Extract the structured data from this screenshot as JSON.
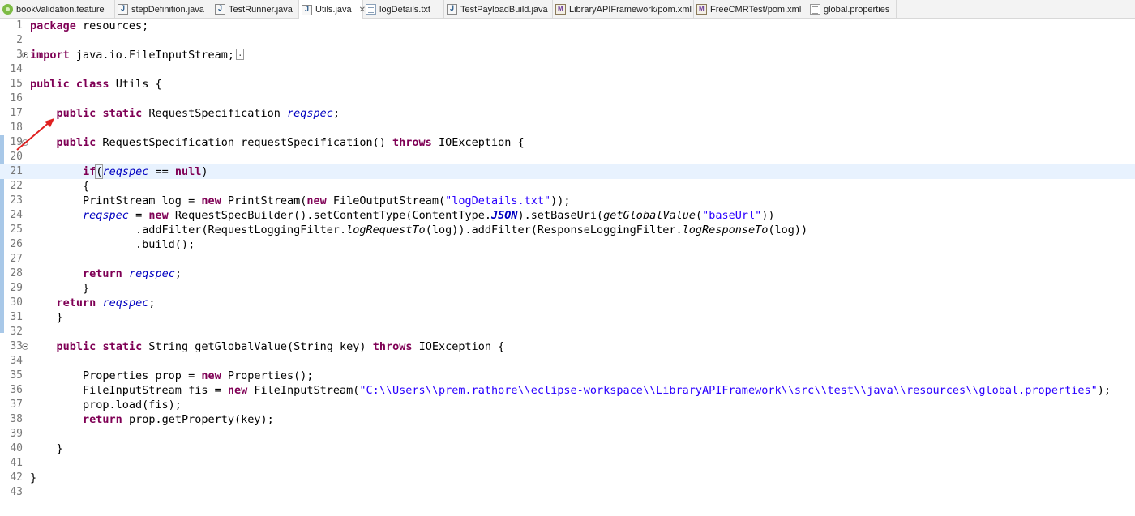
{
  "tabs": [
    {
      "label": "bookValidation.feature",
      "icon": "cucumber-feature-icon",
      "active": false
    },
    {
      "label": "stepDefinition.java",
      "icon": "java-file-icon",
      "active": false
    },
    {
      "label": "TestRunner.java",
      "icon": "java-file-icon",
      "active": false
    },
    {
      "label": "Utils.java",
      "icon": "java-file-icon",
      "active": true,
      "close": "✕"
    },
    {
      "label": "logDetails.txt",
      "icon": "text-file-icon",
      "active": false
    },
    {
      "label": "TestPayloadBuild.java",
      "icon": "java-file-icon",
      "active": false
    },
    {
      "label": "LibraryAPIFramework/pom.xml",
      "icon": "maven-pom-icon",
      "active": false
    },
    {
      "label": "FreeCMRTest/pom.xml",
      "icon": "maven-pom-icon",
      "active": false
    },
    {
      "label": "global.properties",
      "icon": "properties-file-icon",
      "active": false
    }
  ],
  "editor": {
    "current_line": "21",
    "lines": [
      {
        "n": "1",
        "t": [
          "package",
          " resources;"
        ]
      },
      {
        "n": "2",
        "t": []
      },
      {
        "n": "3",
        "t": [
          "import",
          " java.io.FileInputStream;"
        ]
      },
      {
        "n": "14",
        "t": []
      },
      {
        "n": "15",
        "t": [
          "public",
          " ",
          "class",
          " Utils {"
        ]
      },
      {
        "n": "16",
        "t": []
      },
      {
        "n": "17",
        "t": [
          "    ",
          "public",
          " ",
          "static",
          " RequestSpecification ",
          "reqspec",
          ";"
        ]
      },
      {
        "n": "18",
        "t": []
      },
      {
        "n": "19",
        "t": [
          "    ",
          "public",
          " RequestSpecification requestSpecification() ",
          "throws",
          " IOException {"
        ]
      },
      {
        "n": "20",
        "t": []
      },
      {
        "n": "21",
        "t": [
          "        ",
          "if",
          "(",
          "reqspec",
          " == ",
          "null",
          ")"
        ]
      },
      {
        "n": "22",
        "t": [
          "        {"
        ]
      },
      {
        "n": "23",
        "t": [
          "        PrintStream log = ",
          "new",
          " PrintStream(",
          "new",
          " FileOutputStream(",
          "\"logDetails.txt\"",
          "));"
        ]
      },
      {
        "n": "24",
        "t": [
          "        ",
          "reqspec",
          " = ",
          "new",
          " RequestSpecBuilder().setContentType(ContentType.",
          "JSON",
          ").setBaseUri(",
          "getGlobalValue",
          "(",
          "\"baseUrl\"",
          "))"
        ]
      },
      {
        "n": "25",
        "t": [
          "                .addFilter(RequestLoggingFilter.",
          "logRequestTo",
          "(log)).addFilter(ResponseLoggingFilter.",
          "logResponseTo",
          "(log))"
        ]
      },
      {
        "n": "26",
        "t": [
          "                .build();"
        ]
      },
      {
        "n": "27",
        "t": []
      },
      {
        "n": "28",
        "t": [
          "        ",
          "return",
          " ",
          "reqspec",
          ";"
        ]
      },
      {
        "n": "29",
        "t": [
          "        }"
        ]
      },
      {
        "n": "30",
        "t": [
          "    ",
          "return",
          " ",
          "reqspec",
          ";"
        ]
      },
      {
        "n": "31",
        "t": [
          "    }"
        ]
      },
      {
        "n": "32",
        "t": []
      },
      {
        "n": "33",
        "t": [
          "    ",
          "public",
          " ",
          "static",
          " String getGlobalValue(String key) ",
          "throws",
          " IOException {"
        ]
      },
      {
        "n": "34",
        "t": []
      },
      {
        "n": "35",
        "t": [
          "        Properties prop = ",
          "new",
          " Properties();"
        ]
      },
      {
        "n": "36",
        "t": [
          "        FileInputStream fis = ",
          "new",
          " FileInputStream(",
          "\"C:\\\\Users\\\\prem.rathore\\\\eclipse-workspace\\\\LibraryAPIFramework\\\\src\\\\test\\\\java\\\\resources\\\\global.properties\"",
          ");"
        ]
      },
      {
        "n": "37",
        "t": [
          "        prop.load(fis);"
        ]
      },
      {
        "n": "38",
        "t": [
          "        ",
          "return",
          " prop.getProperty(key);"
        ]
      },
      {
        "n": "39",
        "t": []
      },
      {
        "n": "40",
        "t": [
          "    }"
        ]
      },
      {
        "n": "41",
        "t": []
      },
      {
        "n": "42",
        "t": [
          "}"
        ]
      },
      {
        "n": "43",
        "t": []
      }
    ]
  },
  "colors": {
    "keyword": "#7f0055",
    "field": "#0000c0",
    "string": "#2a00ff",
    "current_line_bg": "#e8f2fe",
    "annotation_arrow": "#e02020"
  }
}
